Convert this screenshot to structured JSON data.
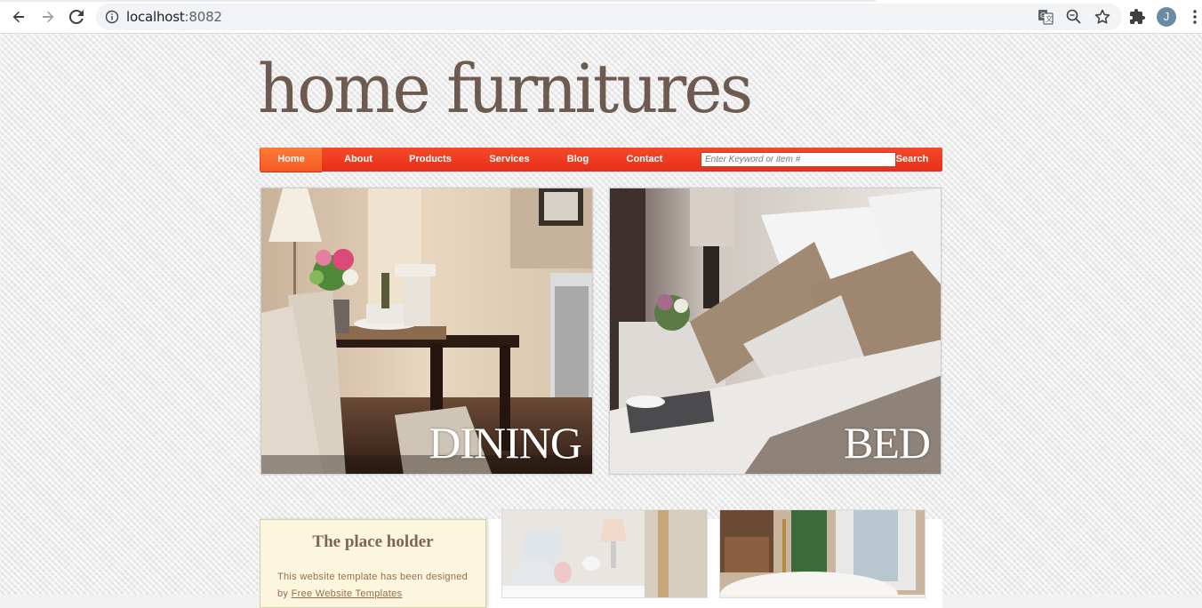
{
  "browser": {
    "url_host": "localhost",
    "url_port": ":8082",
    "avatar_letter": "J",
    "icons": [
      "back-icon",
      "forward-icon",
      "reload-icon",
      "info-icon",
      "translate-icon",
      "zoom-icon",
      "star-icon",
      "extensions-icon",
      "menu-icon"
    ]
  },
  "site": {
    "logo": "home furnitures",
    "nav": {
      "items": [
        "Home",
        "About",
        "Products",
        "Services",
        "Blog",
        "Contact"
      ],
      "active": "Home",
      "search_placeholder": "Enter Keyword or item #",
      "search_label": "Search"
    },
    "features": [
      {
        "caption": "DINING"
      },
      {
        "caption": "BED"
      }
    ],
    "placeholder": {
      "title": "The place holder",
      "text_before": "This website template has been designed by ",
      "link": "Free Website Templates"
    }
  },
  "colors": {
    "accent": "#f03c22",
    "active_tab": "#ff6a2c",
    "logo": "#6d5a50",
    "panel_bg": "#fdf6df"
  }
}
